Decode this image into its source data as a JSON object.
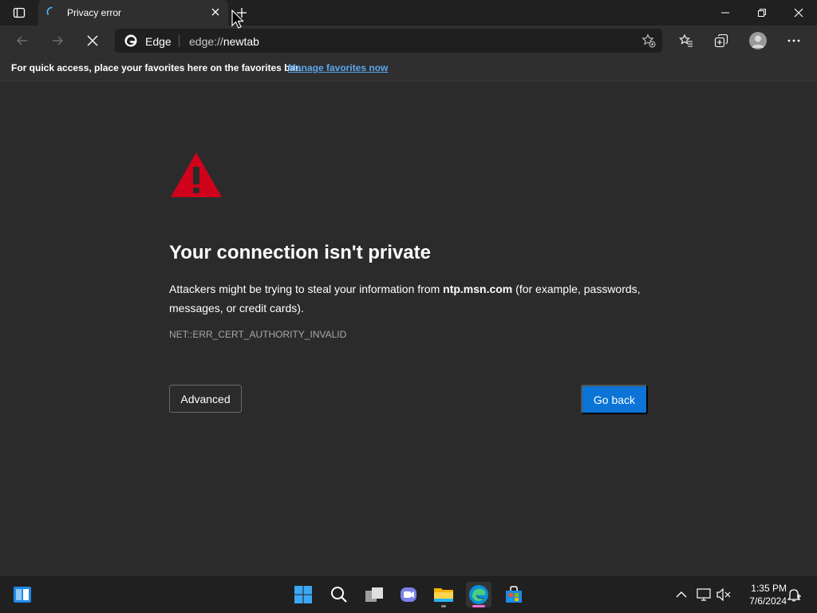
{
  "tab": {
    "title": "Privacy error"
  },
  "address_bar": {
    "site_label": "Edge",
    "url_scheme": "edge://",
    "url_path": "newtab"
  },
  "favorites_bar": {
    "message": "For quick access, place your favorites here on the favorites bar.",
    "link_text": "Manage favorites now"
  },
  "error_page": {
    "title": "Your connection isn't private",
    "description_before": "Attackers might be trying to steal your information from ",
    "domain": "ntp.msn.com",
    "description_after": " (for example, passwords, messages, or credit cards).",
    "error_code": "NET::ERR_CERT_AUTHORITY_INVALID",
    "advanced_label": "Advanced",
    "go_back_label": "Go back"
  },
  "taskbar": {
    "time": "1:35 PM",
    "date": "7/6/2024"
  },
  "colors": {
    "accent_button": "#0b74d6",
    "warning_red": "#d0021b",
    "link": "#5aa7ef",
    "page_background": "#2b2b2b"
  },
  "icons": [
    "tab-actions-icon",
    "loading-icon",
    "close-tab-icon",
    "new-tab-icon",
    "minimize-icon",
    "restore-icon",
    "close-window-icon",
    "back-arrow-icon",
    "forward-arrow-icon",
    "stop-icon",
    "edge-logo-icon",
    "add-favorite-icon",
    "favorites-icon",
    "collections-icon",
    "profile-icon",
    "more-options-icon",
    "warning-icon",
    "start-icon",
    "search-icon",
    "task-view-icon",
    "teams-chat-icon",
    "file-explorer-icon",
    "edge-taskbar-icon",
    "store-icon",
    "show-hidden-icons-icon",
    "network-icon",
    "volume-muted-icon",
    "notifications-icon"
  ]
}
